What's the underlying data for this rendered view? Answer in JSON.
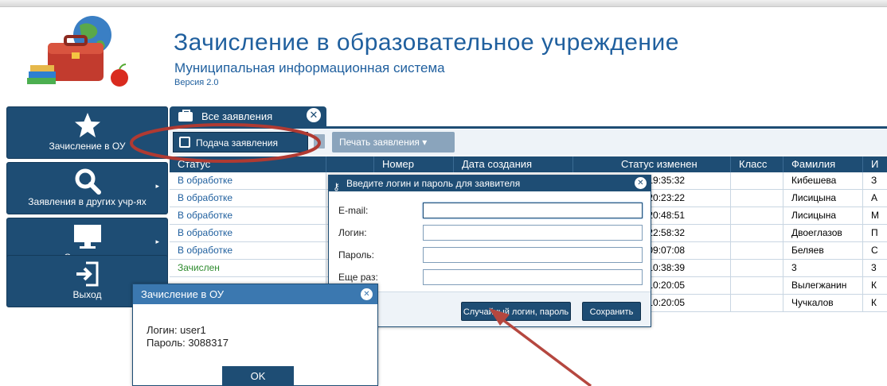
{
  "header": {
    "title": "Зачисление в образовательное учреждение",
    "subtitle": "Муниципальная информационная система",
    "version": "Версия 2.0"
  },
  "sidebar": {
    "items": [
      {
        "label": "Зачисление в ОУ",
        "icon": "star-icon"
      },
      {
        "label": "Заявления в других учр-ях",
        "icon": "search-icon"
      },
      {
        "label": "Секретарь",
        "icon": "monitor-icon"
      },
      {
        "label": "Выход",
        "icon": "exit-icon"
      }
    ]
  },
  "tab": {
    "label": "Все заявления"
  },
  "toolbar": {
    "apply_label": "Подача заявления",
    "print_label": "Печать заявления ▾"
  },
  "table": {
    "columns": [
      "Статус",
      "",
      "Номер",
      "Дата создания",
      "Статус изменен",
      "Класс",
      "Фамилия",
      "И"
    ],
    "rows": [
      {
        "status": "В обработке",
        "changed": "013 19:35:32",
        "class": "",
        "surname": "Кибешева",
        "name": "З"
      },
      {
        "status": "В обработке",
        "changed": "013 20:23:22",
        "class": "",
        "surname": "Лисицына",
        "name": "А"
      },
      {
        "status": "В обработке",
        "changed": "013 20:48:51",
        "class": "",
        "surname": "Лисицына",
        "name": "М"
      },
      {
        "status": "В обработке",
        "changed": "013 22:58:32",
        "class": "",
        "surname": "Двоеглазов",
        "name": "П"
      },
      {
        "status": "В обработке",
        "changed": "013 09:07:08",
        "class": "",
        "surname": "Беляев",
        "name": "С"
      },
      {
        "status": "Зачислен",
        "changed": "013 10:38:39",
        "class": "",
        "surname": "3",
        "name": "3"
      },
      {
        "status": "",
        "changed": "013 10:20:05",
        "class": "",
        "surname": "Вылегжанин",
        "name": "К"
      },
      {
        "status": "",
        "changed": "013 10:20:05",
        "class": "",
        "surname": "Чучкалов",
        "name": "К"
      }
    ]
  },
  "login_dialog": {
    "title": "Введите логин и пароль для заявителя",
    "fields": [
      {
        "label": "E-mail:",
        "value": ""
      },
      {
        "label": "Логин:",
        "value": ""
      },
      {
        "label": "Пароль:",
        "value": ""
      },
      {
        "label": "Еще раз:",
        "value": ""
      }
    ],
    "random_button": "Случайный логин, пароль",
    "save_button": "Сохранить"
  },
  "message_box": {
    "title": "Зачисление в ОУ",
    "login_line": "Логин: user1",
    "password_line": "Пароль: 3088317",
    "ok_button": "OK"
  },
  "colors": {
    "brand": "#1e4d74",
    "title_blue": "#1f5f9e",
    "highlight_ellipse": "#b03a32",
    "arrow": "#b5473f"
  }
}
